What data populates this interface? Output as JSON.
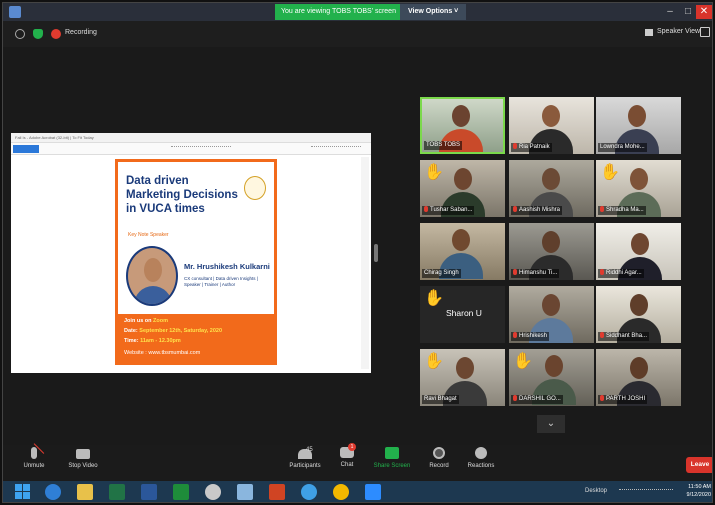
{
  "titlebar": {
    "banner": "You are viewing TOBS TOBS' screen",
    "view_options": "View Options ˅",
    "min": "–",
    "max": "□",
    "close": "✕",
    "accent_green": "#22b14c"
  },
  "topbar": {
    "recording_label": "Recording",
    "speaker_view": "Speaker View"
  },
  "shared_screen": {
    "window_title": "Fall Is - Adobe Acrobat (32-bit) | To Fit Today",
    "poster": {
      "title": "Data driven Marketing Decisions in VUCA times",
      "keynote_label": "Key Note Speaker",
      "speaker_name": "Mr. Hrushikesh Kulkarni",
      "speaker_role": "CX consultant | Data driven Insights | Speaker | Trainer | Author",
      "join_prefix": "Join us on",
      "join_platform": "Zoom",
      "date_label": "Date:",
      "date_value": "September 12th, Saturday, 2020",
      "time_label": "Time:",
      "time_value": "11am - 12.30pm",
      "website": "Website : www.tbsmumbai.com",
      "accent_orange": "#f26a1b",
      "title_blue": "#1a3a7a"
    }
  },
  "participants": [
    {
      "name": "TOBS TOBS",
      "active": true
    },
    {
      "name": "Ria Patnaik",
      "muted": true
    },
    {
      "name": "Lowndra Mohe...",
      "muted": false
    },
    {
      "name": "Tushar Saban...",
      "muted": true,
      "hand": true
    },
    {
      "name": "Aashish Mishra",
      "muted": true
    },
    {
      "name": "Shradha Ma...",
      "muted": true,
      "hand": true
    },
    {
      "name": "Chirag Singh",
      "muted": false
    },
    {
      "name": "Himanshu Ti...",
      "muted": true
    },
    {
      "name": "Riddhi Agar...",
      "muted": true
    },
    {
      "name": "Sharon U",
      "muted": false,
      "hand": true,
      "video_off": true
    },
    {
      "name": "Hrishikesh",
      "muted": true
    },
    {
      "name": "Siddhant Bha...",
      "muted": true
    },
    {
      "name": "Ravi Bhagat",
      "muted": false,
      "hand": true
    },
    {
      "name": "DARSHIL GO...",
      "muted": true,
      "hand": true
    },
    {
      "name": "PARTH JOSHI",
      "muted": true
    }
  ],
  "grid_nav": "⌄",
  "controls": {
    "unmute": "Unmute",
    "stop_video": "Stop Video",
    "participants": "Participants",
    "participants_count": "45",
    "chat": "Chat",
    "chat_badge": "1",
    "share_screen": "Share Screen",
    "record": "Record",
    "reactions": "Reactions",
    "leave": "Leave"
  },
  "taskbar": {
    "desktop_label": "Desktop",
    "time": "11:50 AM",
    "date": "9/12/2020"
  }
}
